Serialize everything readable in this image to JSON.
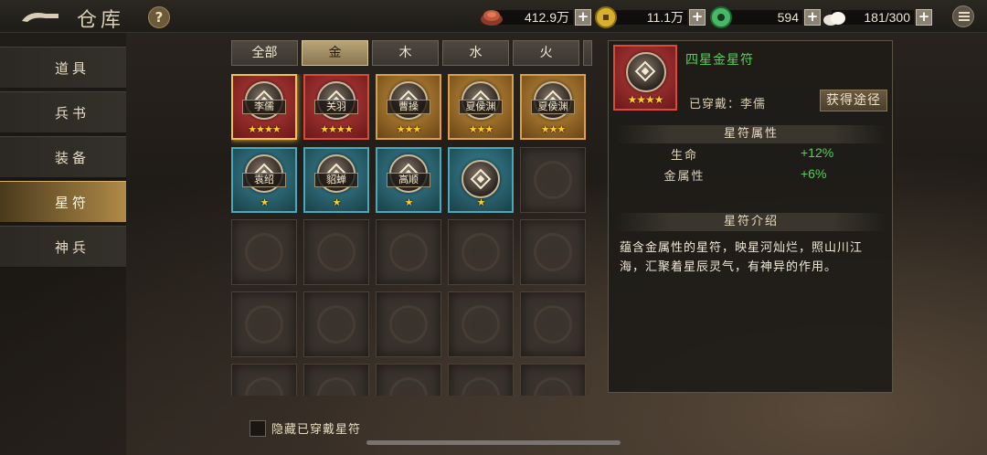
{
  "header": {
    "title": "仓库",
    "help_label": "?"
  },
  "resources": [
    {
      "icon": "bronze-ingot-icon",
      "amount": "412.9万",
      "plus": "+"
    },
    {
      "icon": "gold-coin-icon",
      "amount": "11.1万",
      "plus": "+"
    },
    {
      "icon": "jade-coin-icon",
      "amount": "594",
      "plus": "+"
    },
    {
      "icon": "grain-sack-icon",
      "amount": "181/300",
      "plus": "+"
    }
  ],
  "sidebar": {
    "items": [
      {
        "label": "道具",
        "active": false
      },
      {
        "label": "兵书",
        "active": false
      },
      {
        "label": "装备",
        "active": false
      },
      {
        "label": "星符",
        "active": true
      },
      {
        "label": "神兵",
        "active": false
      }
    ]
  },
  "filters": {
    "tabs": [
      {
        "label": "全部",
        "active": false
      },
      {
        "label": "金",
        "active": true
      },
      {
        "label": "木",
        "active": false
      },
      {
        "label": "水",
        "active": false
      },
      {
        "label": "火",
        "active": false
      }
    ]
  },
  "inventory": {
    "items": [
      {
        "name": "李儒",
        "stars": "★★★★",
        "color": "red",
        "selected": true
      },
      {
        "name": "关羽",
        "stars": "★★★★",
        "color": "red",
        "selected": false
      },
      {
        "name": "曹操",
        "stars": "★★★",
        "color": "gold",
        "selected": false
      },
      {
        "name": "夏侯渊",
        "stars": "★★★",
        "color": "gold",
        "selected": false
      },
      {
        "name": "夏侯渊",
        "stars": "★★★",
        "color": "gold",
        "selected": false
      },
      {
        "name": "袁绍",
        "stars": "★",
        "color": "blue",
        "selected": false
      },
      {
        "name": "貂蝉",
        "stars": "★",
        "color": "blue",
        "selected": false
      },
      {
        "name": "高顺",
        "stars": "★",
        "color": "blue",
        "selected": false
      },
      {
        "name": "",
        "stars": "★",
        "color": "blue",
        "selected": false
      }
    ]
  },
  "hide_worn": {
    "label": "隐藏已穿戴星符",
    "checked": false
  },
  "detail": {
    "name": "四星金星符",
    "stars": "★★★★",
    "worn_by": "已穿戴：李儒",
    "obtain_button": "获得途径",
    "attr_section": "星符属性",
    "attributes": [
      {
        "key": "生命",
        "value": "+12%"
      },
      {
        "key": "金属性",
        "value": "+6%"
      }
    ],
    "intro_section": "星符介绍",
    "description": "蕴含金属性的星符，映星河灿烂，照山川江海，汇聚着星辰灵气，有神异的作用。"
  },
  "colors": {
    "accent_gold": "#b08a48",
    "stat_green": "#58d058",
    "rarity_red": "#d84a3a",
    "rarity_gold": "#d8a048",
    "rarity_blue": "#4aa8b8"
  }
}
